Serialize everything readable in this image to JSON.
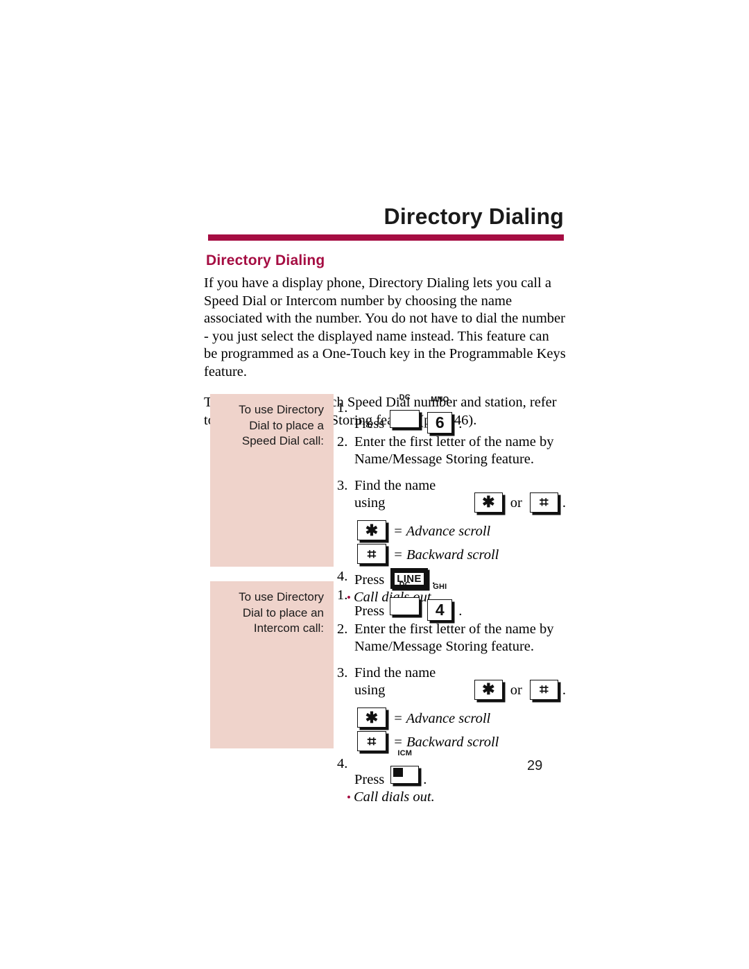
{
  "page": {
    "running_head": "Directory Dialing",
    "section_title": "Directory Dialing",
    "folio": "29",
    "accent_color": "#a50d42",
    "shade_color": "#efd3cb"
  },
  "intro": {
    "paragraph_1": "If you have a display phone, Directory Dialing lets you call a Speed Dial or Intercom number by choosing the name associated with the number. You do not have to dial the number - you just select the displayed name instead. This feature can be programmed as a One-Touch key in the Programmable Keys feature.",
    "paragraph_2": "To store a name for each Speed Dial number and station, refer to the Name/Message Storing feature (page 46)."
  },
  "procedures": [
    {
      "label": "To use Directory Dial to place a Speed Dial call:",
      "steps": {
        "num1": "1.",
        "press_1": "Press",
        "key_dc_caption": "DC",
        "key_dc_face": "",
        "key_digit_caption": "MNO",
        "key_digit_face": "6",
        "period_1": ".",
        "num2": "2.",
        "step2_line1": "Enter the first letter of the name by",
        "step2_line2": "Name/Message Storing feature.",
        "num3": "3.",
        "step3_prefix": "Find the name using",
        "key_star_face": "✱",
        "or": "or",
        "key_hash_face": "⌗",
        "period_3": ".",
        "legend_star_face": "✱",
        "legend_star_text": "= Advance scroll",
        "legend_hash_face": "⌗",
        "legend_hash_text": "= Backward scroll",
        "num4": "4.",
        "press_4": "Press",
        "key_final_type": "line",
        "key_final_caption": "",
        "key_final_face": "LINE",
        "period_4": ".",
        "note_bullet": "•",
        "note_text": "Call dials out."
      }
    },
    {
      "label": "To use Directory Dial to place an Intercom call:",
      "steps": {
        "num1": "1.",
        "press_1": "Press",
        "key_dc_caption": "DC",
        "key_dc_face": "",
        "key_digit_caption": "GHI",
        "key_digit_face": "4",
        "period_1": ".",
        "num2": "2.",
        "step2_line1": "Enter the first letter of the name by",
        "step2_line2": "Name/Message Storing feature.",
        "num3": "3.",
        "step3_prefix": "Find the name using",
        "key_star_face": "✱",
        "or": "or",
        "key_hash_face": "⌗",
        "period_3": ".",
        "legend_star_face": "✱",
        "legend_star_text": "= Advance scroll",
        "legend_hash_face": "⌗",
        "legend_hash_text": "= Backward scroll",
        "num4": "4.",
        "press_4": "Press",
        "key_final_type": "icm",
        "key_final_caption": "ICM",
        "key_final_face": "",
        "period_4": ".",
        "note_bullet": "•",
        "note_text": "Call dials out."
      }
    }
  ]
}
